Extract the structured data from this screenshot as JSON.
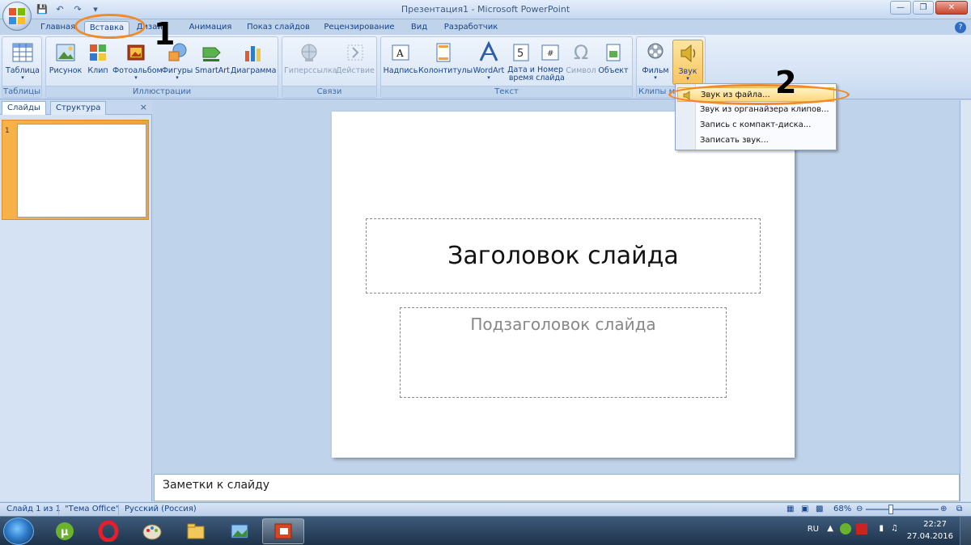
{
  "window": {
    "title": "Презентация1 - Microsoft PowerPoint"
  },
  "tabs": [
    "Главная",
    "Вставка",
    "Дизайн",
    "Анимация",
    "Показ слайдов",
    "Рецензирование",
    "Вид",
    "Разработчик"
  ],
  "ribbon": {
    "groups": {
      "tables": "Таблицы",
      "illustrations": "Иллюстрации",
      "links": "Связи",
      "text": "Текст",
      "media": "Клипы мультимедиа"
    },
    "buttons": {
      "table": "Таблица",
      "picture": "Рисунок",
      "clip": "Клип",
      "photoalbum": "Фотоальбом",
      "shapes": "Фигуры",
      "smartart": "SmartArt",
      "chart": "Диаграмма",
      "hyperlink": "Гиперссылка",
      "action": "Действие",
      "textbox": "Надпись",
      "headerfooter": "Колонтитулы",
      "wordart": "WordArt",
      "datetime_1": "Дата и",
      "datetime_2": "время",
      "slidenum_1": "Номер",
      "slidenum_2": "слайда",
      "symbol": "Символ",
      "object": "Объект",
      "movie": "Фильм",
      "sound": "Звук",
      "datetime_icon_digit": "5"
    }
  },
  "sound_menu": {
    "items": [
      "Звук из файла...",
      "Звук из органайзера клипов...",
      "Запись с компакт-диска...",
      "Записать звук..."
    ]
  },
  "left_pane": {
    "tabs": [
      "Слайды",
      "Структура"
    ],
    "close": "×",
    "slide_number": "1"
  },
  "slide": {
    "title": "Заголовок слайда",
    "subtitle": "Подзаголовок слайда"
  },
  "notes": {
    "placeholder": "Заметки к слайду"
  },
  "status_bar": {
    "slide": "Слайд 1 из 1",
    "theme": "\"Тема Office\"",
    "language": "Русский (Россия)",
    "zoom": "68%"
  },
  "taskbar": {
    "lang": "RU",
    "time": "22:27",
    "date": "27.04.2016"
  },
  "annotations": {
    "one": "1",
    "two": "2"
  },
  "colors": {
    "accent": "#f08a2a",
    "ribbon": "#dbe7f6",
    "highlight": "#ffd77a"
  }
}
